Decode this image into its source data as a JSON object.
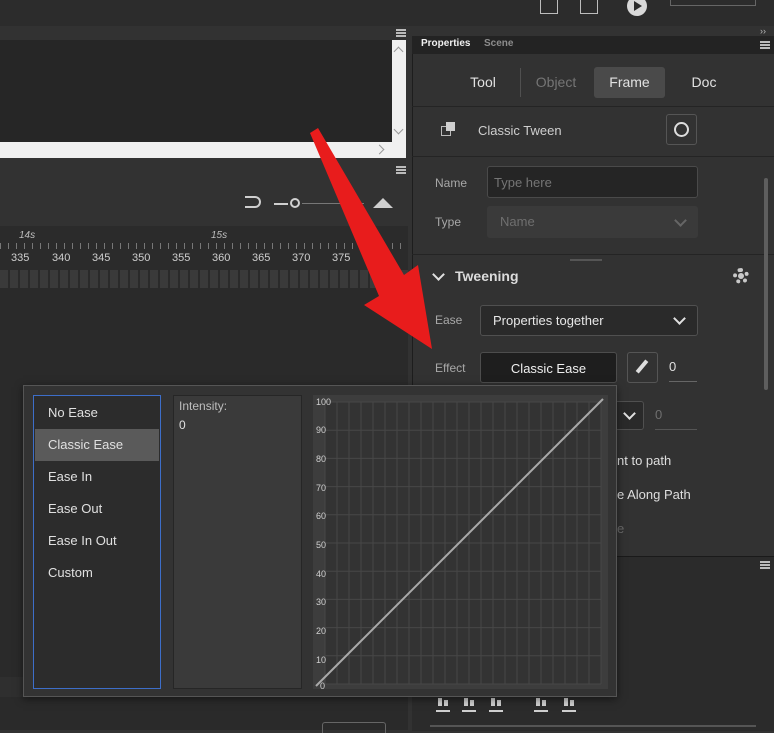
{
  "right_panel": {
    "tabs": [
      "Properties",
      "Scene"
    ],
    "segments": [
      "Tool",
      "Object",
      "Frame",
      "Doc"
    ],
    "active_segment": "Frame",
    "section_title": "Classic Tween",
    "name_label": "Name",
    "name_placeholder": "Type here",
    "type_label": "Type",
    "type_value": "Name",
    "tweening_title": "Tweening",
    "ease_label": "Ease",
    "ease_value": "Properties together",
    "effect_label": "Effect",
    "effect_value": "Classic Ease",
    "effect_number": "0",
    "second_number": "0",
    "option_orient": "nt to path",
    "option_scale": "e Along Path",
    "option_faded": "e"
  },
  "timeline": {
    "seconds": [
      "14s",
      "15s"
    ],
    "frame_numbers": [
      "335",
      "340",
      "345",
      "350",
      "355",
      "360",
      "365",
      "370",
      "375",
      "3"
    ]
  },
  "ease_popup": {
    "items": [
      "No Ease",
      "Classic Ease",
      "Ease In",
      "Ease Out",
      "Ease In Out",
      "Custom"
    ],
    "selected": "Classic Ease",
    "intensity_label": "Intensity:",
    "intensity_value": "0",
    "y_ticks": [
      "100",
      "90",
      "80",
      "70",
      "60",
      "50",
      "40",
      "30",
      "20",
      "10",
      "0"
    ]
  },
  "colors": {
    "accent_blue": "#3d6ec9",
    "arrow_red": "#e81c1c"
  }
}
